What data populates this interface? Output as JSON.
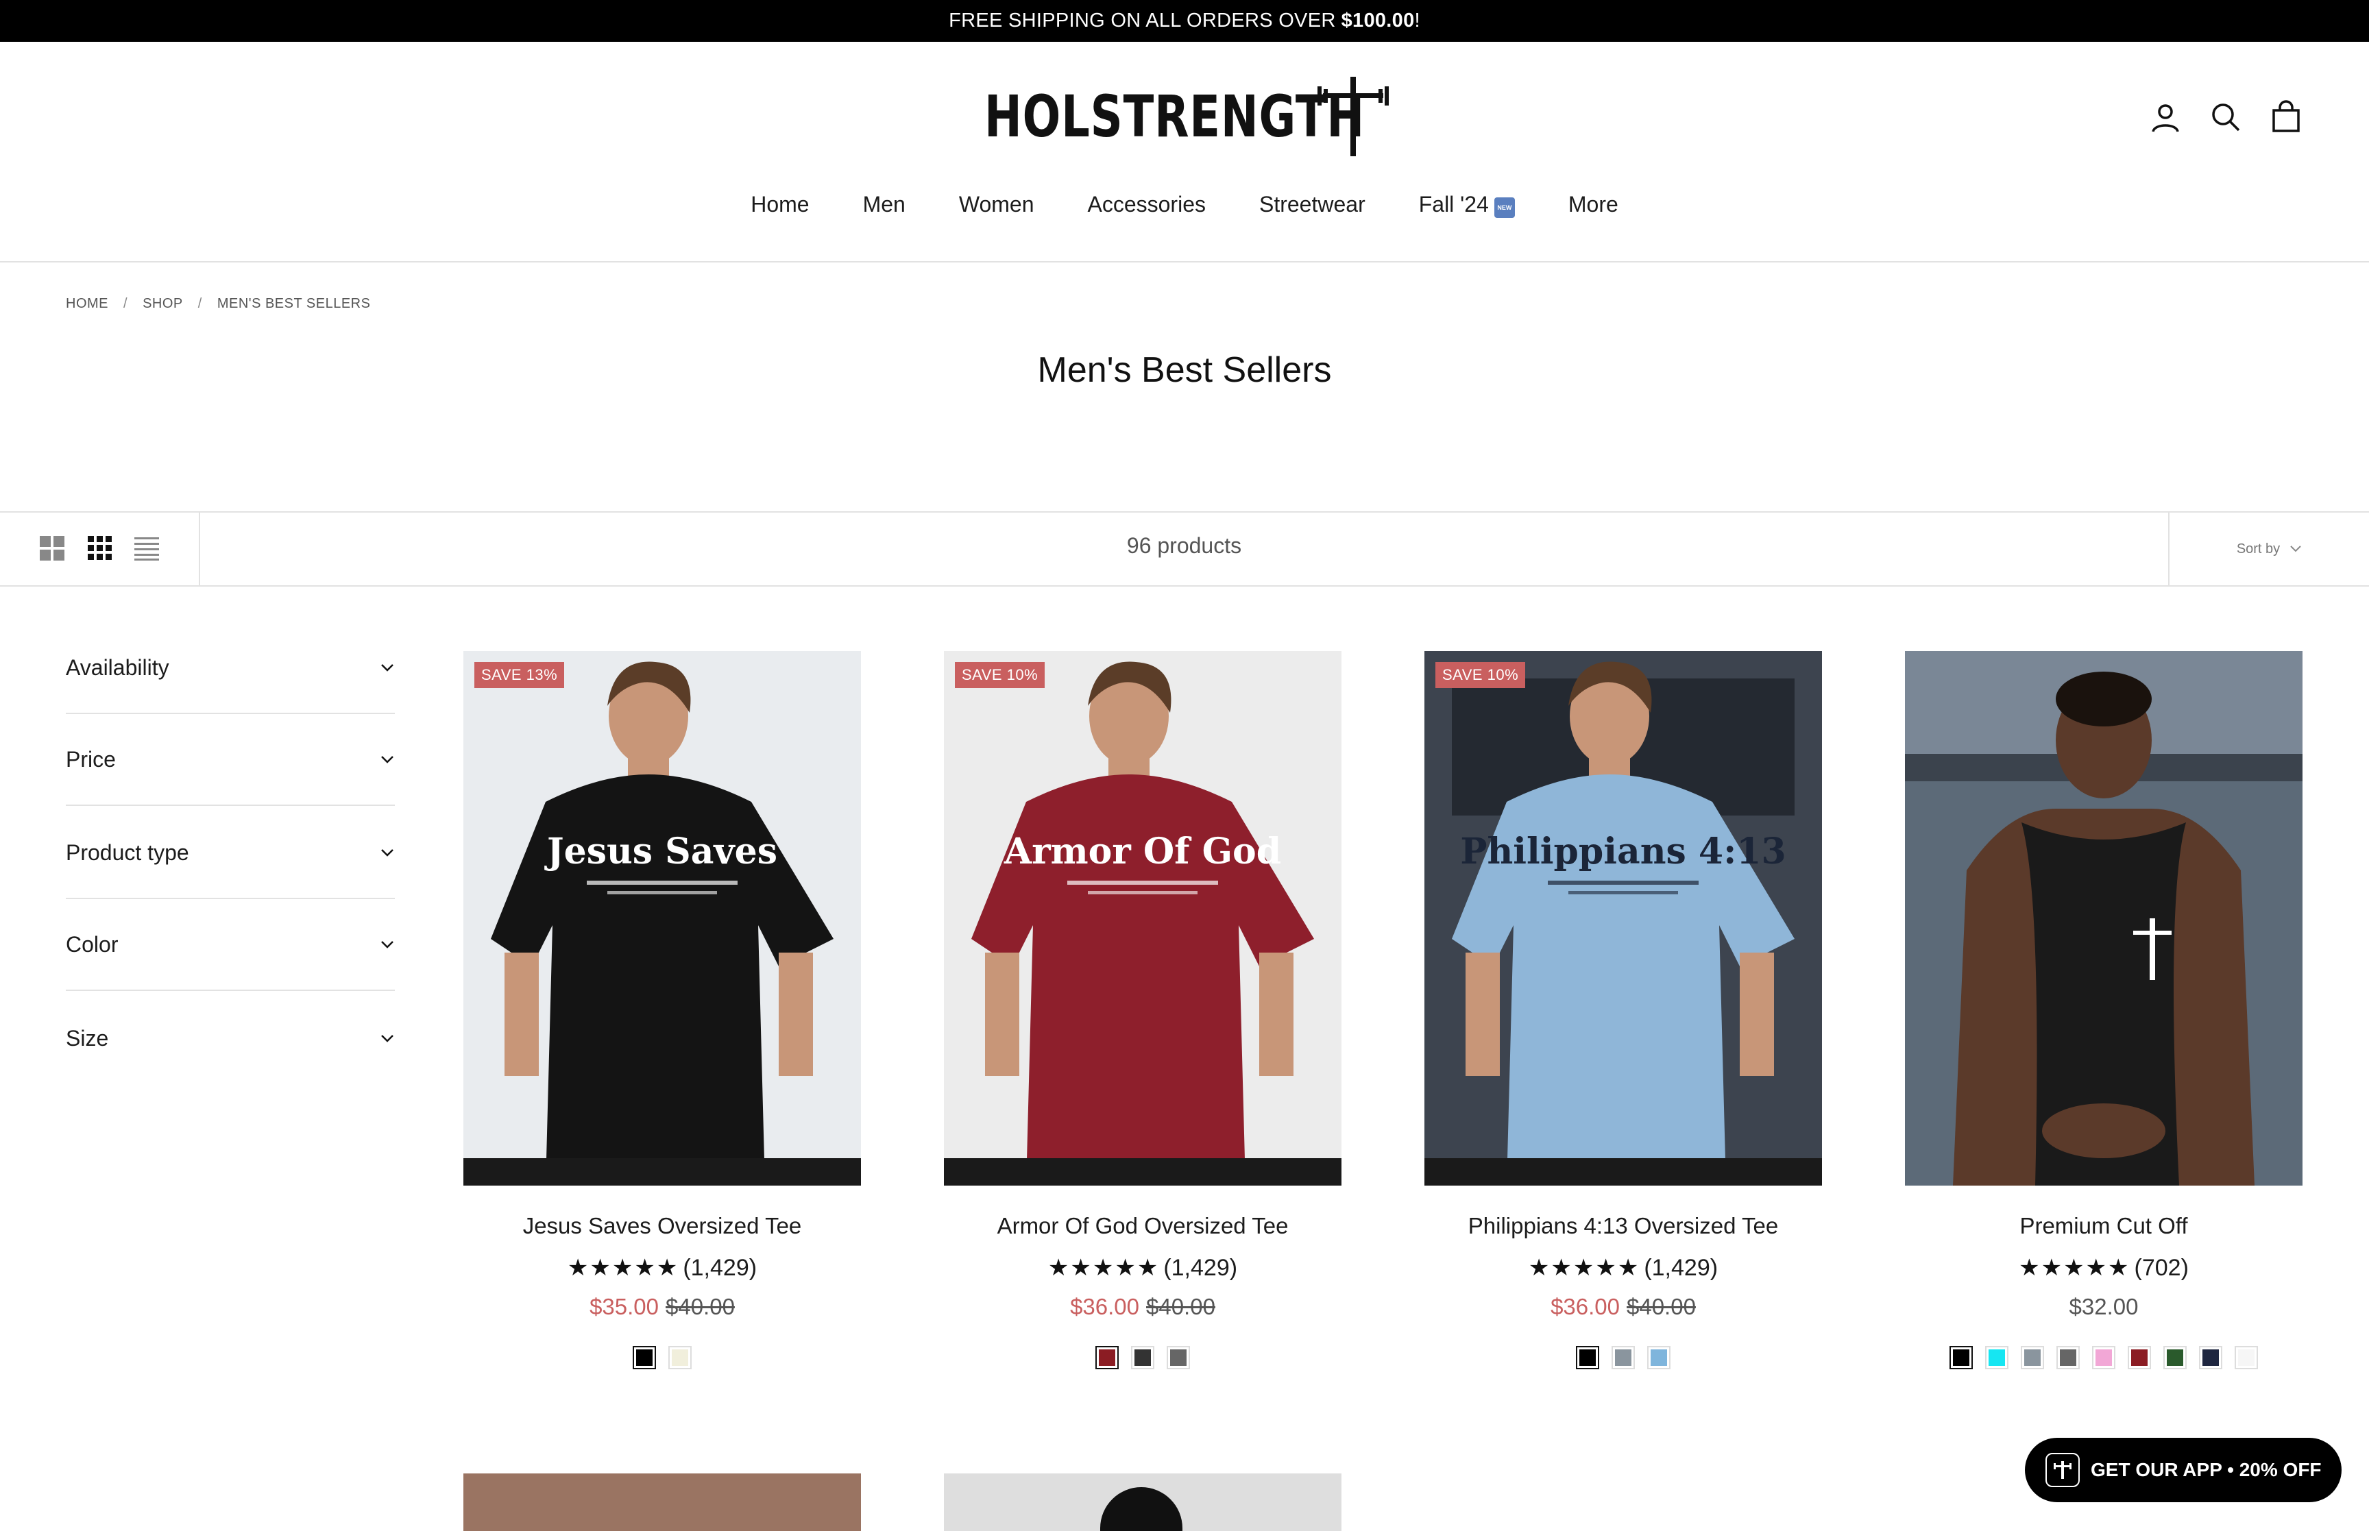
{
  "announcement": {
    "text": "FREE SHIPPING ON ALL ORDERS OVER",
    "amount": "$100.00",
    "suffix": "!"
  },
  "brand": {
    "name": "HOLSTRENGTH"
  },
  "nav": [
    {
      "label": "Home"
    },
    {
      "label": "Men"
    },
    {
      "label": "Women"
    },
    {
      "label": "Accessories"
    },
    {
      "label": "Streetwear"
    },
    {
      "label": "Fall '24",
      "badge": "NEW"
    },
    {
      "label": "More"
    }
  ],
  "header_icons": [
    "account-icon",
    "search-icon",
    "cart-icon"
  ],
  "breadcrumb": {
    "home": "HOME",
    "shop": "SHOP",
    "current": "MEN'S BEST SELLERS",
    "sep": "/"
  },
  "page_title": "Men's Best Sellers",
  "toolbar": {
    "product_count": "96 products",
    "sort_label": "Sort by"
  },
  "filters": [
    {
      "label": "Availability"
    },
    {
      "label": "Price"
    },
    {
      "label": "Product type"
    },
    {
      "label": "Color"
    },
    {
      "label": "Size"
    }
  ],
  "products": [
    {
      "badge": "SAVE 13%",
      "title": "Jesus Saves Oversized Tee",
      "stars": "★★★★★",
      "reviews": "(1,429)",
      "sale_price": "$35.00",
      "regular_price": "$40.00",
      "rating": 5,
      "shirt_color": "#141414",
      "print_text": "Jesus Saves",
      "bg": "#e9ecef",
      "swatches": [
        "#000000",
        "#f1efdc"
      ]
    },
    {
      "badge": "SAVE 10%",
      "title": "Armor Of God Oversized Tee",
      "stars": "★★★★★",
      "reviews": "(1,429)",
      "sale_price": "$36.00",
      "regular_price": "$40.00",
      "rating": 5,
      "shirt_color": "#8e1f2c",
      "print_text": "Armor Of God",
      "bg": "#ececec",
      "swatches": [
        "#8b1c23",
        "#333333",
        "#666666"
      ]
    },
    {
      "badge": "SAVE 10%",
      "title": "Philippians 4:13 Oversized Tee",
      "stars": "★★★★★",
      "reviews": "(1,429)",
      "sale_price": "$36.00",
      "regular_price": "$40.00",
      "rating": 5,
      "shirt_color": "#8fb6d8",
      "print_text": "Philippians 4:13",
      "bg": "#2a2f38",
      "swatches": [
        "#000000",
        "#8a959e",
        "#7fb5dc"
      ]
    },
    {
      "badge": "",
      "title": "Premium Cut Off",
      "stars": "★★★★★",
      "reviews": "(702)",
      "price": "$32.00",
      "rating": 5,
      "shirt_color": "#1a1a1a",
      "print_text": "",
      "bg": "#5c6a78",
      "swatches": [
        "#000000",
        "#16e6f2",
        "#8a959e",
        "#666666",
        "#f2a7d6",
        "#8b1c23",
        "#2a5a2c",
        "#1e2640",
        "#f6f6f6"
      ]
    }
  ],
  "app_banner": {
    "label": "GET OUR APP • 20% OFF"
  }
}
